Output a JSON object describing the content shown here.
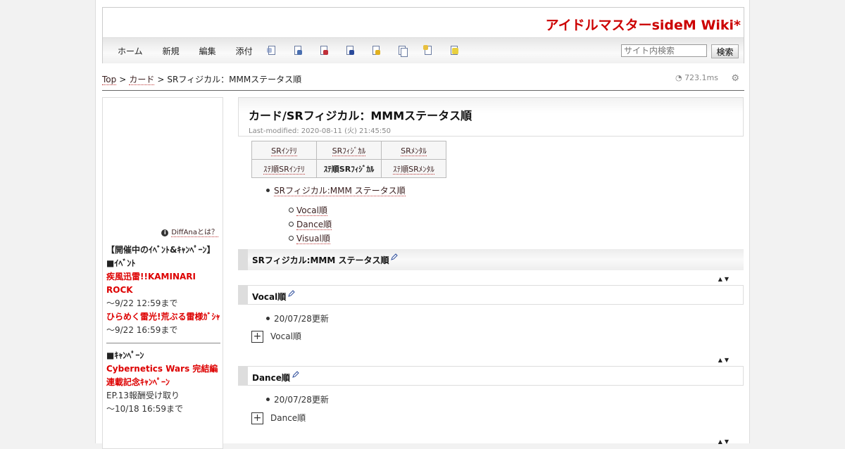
{
  "site": {
    "title": "アイドルマスターsideM Wiki*"
  },
  "menu": [
    "ホーム",
    "新規",
    "編集",
    "添付"
  ],
  "toolbar_icons": [
    "copy-icon",
    "rename-icon",
    "diff-icon",
    "backup-icon",
    "freeze-icon",
    "list-icon",
    "recent-icon",
    "help-icon"
  ],
  "search": {
    "placeholder": "サイト内検索",
    "button": "検索"
  },
  "breadcrumb": {
    "top": "Top",
    "parent": "カード",
    "current": "SRフィジカル：MMMステータス順"
  },
  "perf": "723.1ms",
  "sidebar": {
    "diffana": "DiffAnaとは？",
    "section_title": "【開催中のｲﾍﾞﾝﾄ&ｷｬﾝﾍﾟｰﾝ】",
    "event_heading": "■ｲﾍﾞﾝﾄ",
    "events": [
      {
        "name": "疾風迅雷!!KAMINARI ROCK",
        "until": "～9/22 12:59まで"
      },
      {
        "name": "ひらめく雷光!荒ぶる雷様ｶﾞｼｬ",
        "until": "～9/22 16:59まで"
      }
    ],
    "campaign_heading": "■ｷｬﾝﾍﾟｰﾝ",
    "campaign": {
      "name": "Cybernetics Wars 完結編連載記念ｷｬﾝﾍﾟｰﾝ",
      "desc": "EP.13報酬受け取り",
      "until": "～10/18 16:59まで"
    }
  },
  "main": {
    "title": "カード/SRフィジカル：MMMステータス順",
    "modified": "Last-modified: 2020-08-11 (火) 21:45:50",
    "nav_table": [
      [
        "SRｲﾝﾃﾘ",
        "SRﾌｨｼﾞｶﾙ",
        "SRﾒﾝﾀﾙ"
      ],
      [
        "ｽﾃ順SRｲﾝﾃﾘ",
        "ｽﾃ順SRﾌｨｼﾞｶﾙ",
        "ｽﾃ順SRﾒﾝﾀﾙ"
      ]
    ],
    "toc": {
      "top": "SRフィジカル:MMM ステータス順",
      "items": [
        "Vocal順",
        "Dance順",
        "Visual順"
      ]
    },
    "section_h2": "SRフィジカル:MMM ステータス順",
    "arrows": "▲▼",
    "sections": [
      {
        "heading": "Vocal順",
        "update": "20/07/28更新",
        "fold": "Vocal順",
        "fold_symbol": "+"
      },
      {
        "heading": "Dance順",
        "update": "20/07/28更新",
        "fold": "Dance順",
        "fold_symbol": "+"
      }
    ]
  },
  "colors": {
    "title_red": "#cc0000",
    "link_underline": "#bb3333"
  }
}
